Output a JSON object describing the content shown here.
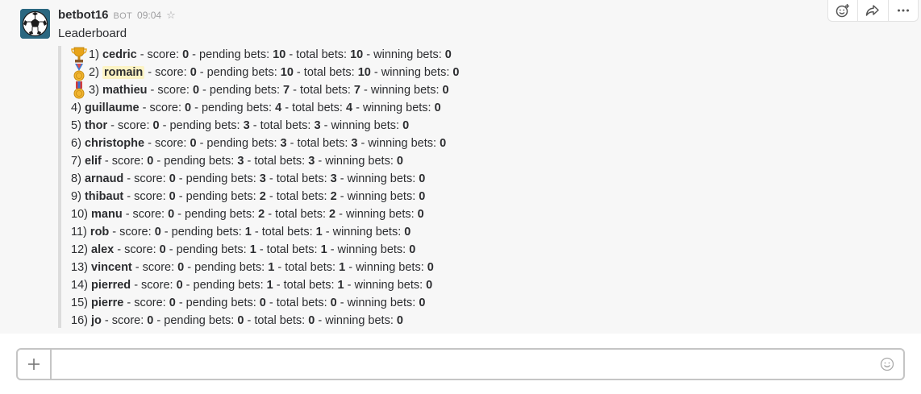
{
  "message": {
    "sender": "betbot16",
    "bot_tag": "BOT",
    "time": "09:04",
    "text": "Leaderboard"
  },
  "leaderboard": [
    {
      "rank": "1)",
      "name": "cedric",
      "score": "0",
      "pending": "10",
      "total": "10",
      "winning": "0",
      "medal": "trophy"
    },
    {
      "rank": "2)",
      "name": "romain",
      "score": "0",
      "pending": "10",
      "total": "10",
      "winning": "0",
      "medal": "gold-medal",
      "highlight": true
    },
    {
      "rank": "3)",
      "name": "mathieu",
      "score": "0",
      "pending": "7",
      "total": "7",
      "winning": "0",
      "medal": "sports-medal"
    },
    {
      "rank": "4)",
      "name": "guillaume",
      "score": "0",
      "pending": "4",
      "total": "4",
      "winning": "0"
    },
    {
      "rank": "5)",
      "name": "thor",
      "score": "0",
      "pending": "3",
      "total": "3",
      "winning": "0"
    },
    {
      "rank": "6)",
      "name": "christophe",
      "score": "0",
      "pending": "3",
      "total": "3",
      "winning": "0"
    },
    {
      "rank": "7)",
      "name": "elif",
      "score": "0",
      "pending": "3",
      "total": "3",
      "winning": "0"
    },
    {
      "rank": "8)",
      "name": "arnaud",
      "score": "0",
      "pending": "3",
      "total": "3",
      "winning": "0"
    },
    {
      "rank": "9)",
      "name": "thibaut",
      "score": "0",
      "pending": "2",
      "total": "2",
      "winning": "0"
    },
    {
      "rank": "10)",
      "name": "manu",
      "score": "0",
      "pending": "2",
      "total": "2",
      "winning": "0"
    },
    {
      "rank": "11)",
      "name": "rob",
      "score": "0",
      "pending": "1",
      "total": "1",
      "winning": "0"
    },
    {
      "rank": "12)",
      "name": "alex",
      "score": "0",
      "pending": "1",
      "total": "1",
      "winning": "0"
    },
    {
      "rank": "13)",
      "name": "vincent",
      "score": "0",
      "pending": "1",
      "total": "1",
      "winning": "0"
    },
    {
      "rank": "14)",
      "name": "pierred",
      "score": "0",
      "pending": "1",
      "total": "1",
      "winning": "0"
    },
    {
      "rank": "15)",
      "name": "pierre",
      "score": "0",
      "pending": "0",
      "total": "0",
      "winning": "0"
    },
    {
      "rank": "16)",
      "name": "jo",
      "score": "0",
      "pending": "0",
      "total": "0",
      "winning": "0"
    }
  ],
  "labels": {
    "score": " - score: ",
    "pending": " - pending bets: ",
    "total": " - total bets: ",
    "winning": " - winning bets: "
  },
  "actions": {
    "icons": [
      "add-reaction-icon",
      "share-icon",
      "more-actions-icon"
    ]
  },
  "composer": {
    "placeholder": "",
    "value": ""
  },
  "colors": {
    "highlight": "#fcf3c4",
    "attachment_border": "#dcdcdc",
    "message_bg": "#f7f7f7"
  }
}
